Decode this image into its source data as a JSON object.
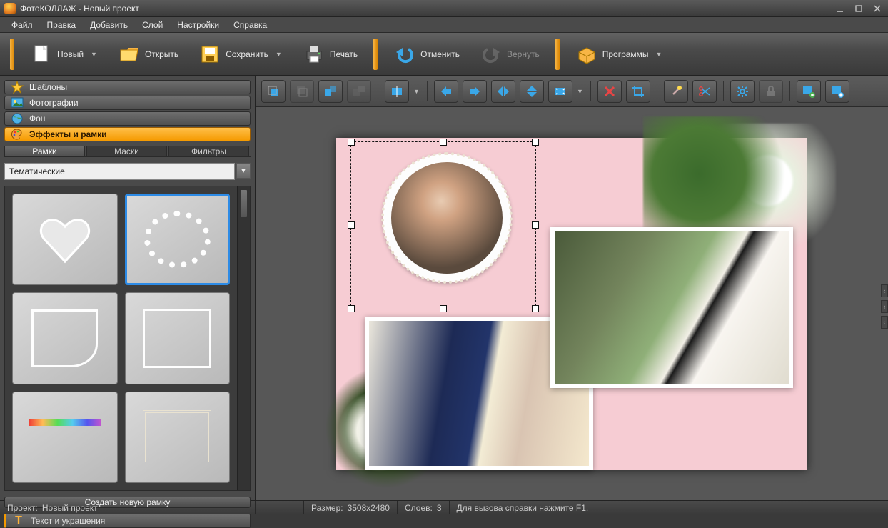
{
  "app": {
    "title": "ФотоКОЛЛАЖ - Новый проект"
  },
  "menu": {
    "file": "Файл",
    "edit": "Правка",
    "add": "Добавить",
    "layer": "Слой",
    "settings": "Настройки",
    "help": "Справка"
  },
  "toolbar": {
    "new": "Новый",
    "open": "Открыть",
    "save": "Сохранить",
    "print": "Печать",
    "undo": "Отменить",
    "redo": "Вернуть",
    "programs": "Программы"
  },
  "sidebar": {
    "templates": "Шаблоны",
    "photos": "Фотографии",
    "background": "Фон",
    "effects": "Эффекты и рамки",
    "text_deco": "Текст и украшения"
  },
  "subtabs": {
    "frames": "Рамки",
    "masks": "Маски",
    "filters": "Фильтры"
  },
  "category": {
    "selected": "Тематические"
  },
  "buttons": {
    "create_frame": "Создать новую рамку"
  },
  "status": {
    "project_label": "Проект:",
    "project_name": "Новый проект",
    "size_label": "Размер:",
    "size_value": "3508x2480",
    "layers_label": "Слоев:",
    "layers_value": "3",
    "help_hint": "Для вызова справки нажмите F1."
  },
  "ws_tools": {
    "front": "bring-front-icon",
    "back": "send-back-icon",
    "forward": "bring-forward-icon",
    "backward": "send-backward-icon",
    "align": "align-icon",
    "flip_h": "flip-h-icon",
    "flip_v": "flip-v-icon",
    "mirror_h": "mirror-h-icon",
    "mirror_v": "mirror-v-icon",
    "fit": "fit-icon",
    "delete": "delete-icon",
    "crop": "crop-icon",
    "wand": "wand-icon",
    "cut": "cut-icon",
    "settings": "settings-icon",
    "lock": "lock-icon",
    "add_img": "add-image-icon",
    "effects": "effects-icon"
  }
}
